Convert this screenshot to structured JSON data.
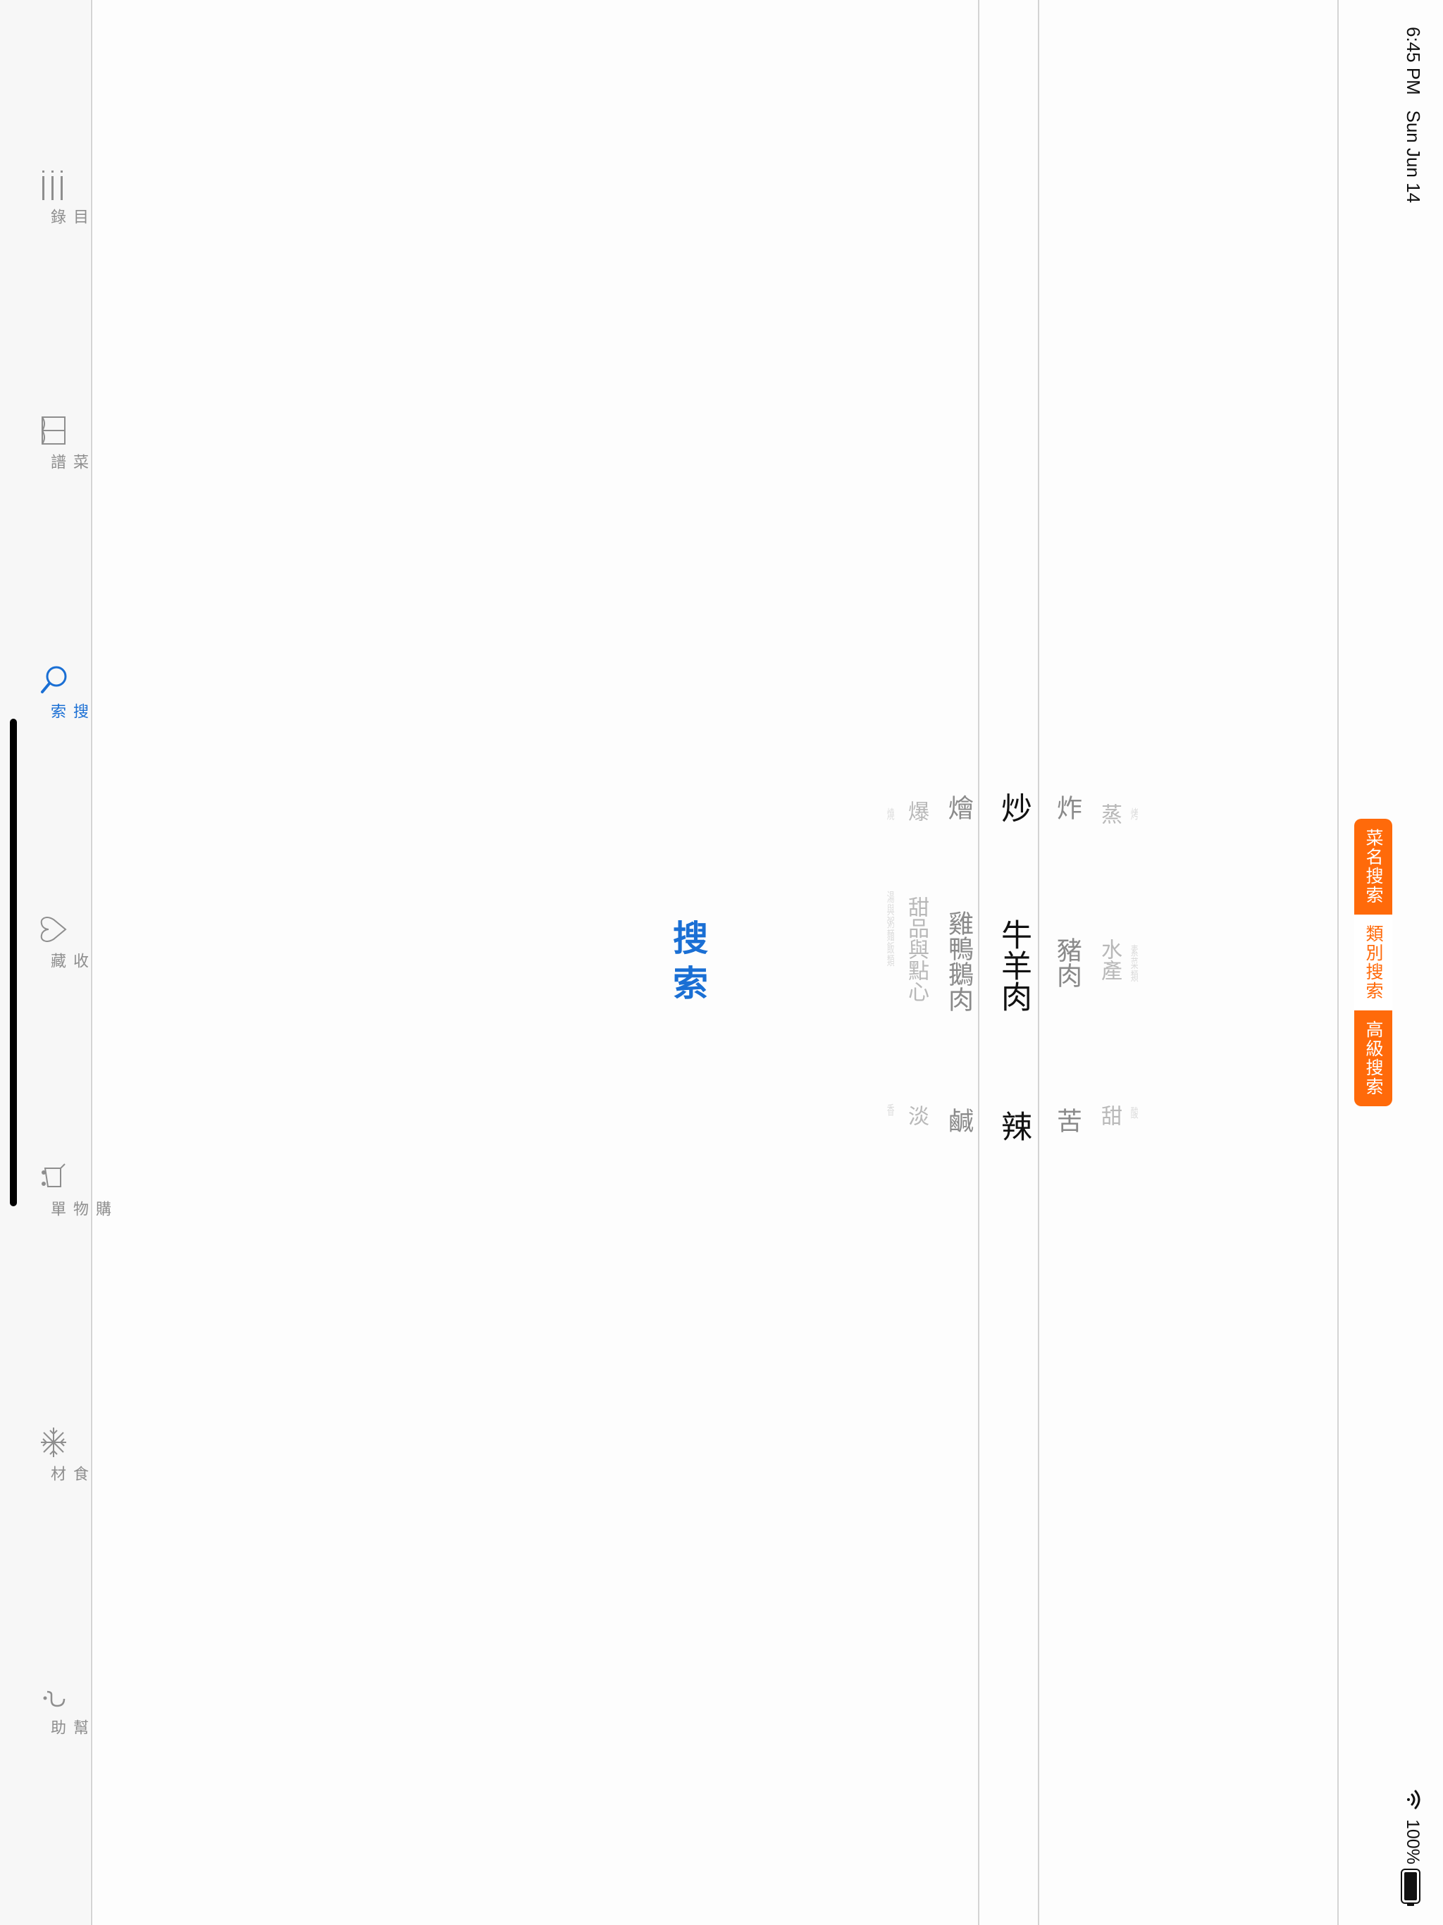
{
  "status_bar": {
    "time_date": "6:45 PM   Sun Jun 14",
    "battery": "100%"
  },
  "segmented_control": {
    "items": [
      {
        "label": "菜名搜索",
        "state": "active"
      },
      {
        "label": "類別搜索",
        "state": "inactive"
      },
      {
        "label": "高級搜索",
        "state": "active"
      }
    ],
    "accent_color": "#ff6a0a"
  },
  "pickers": {
    "cooking_method": {
      "items": [
        "蒸",
        "炸",
        "炒",
        "燴",
        "爆"
      ],
      "selected": "炒"
    },
    "ingredient": {
      "items": [
        "水產",
        "豬肉",
        "牛羊肉",
        "雞鴨鵝肉",
        "甜品與點心"
      ],
      "selected": "牛羊肉"
    },
    "flavor": {
      "items": [
        "甜",
        "苦",
        "辣",
        "鹹",
        "淡"
      ],
      "selected": "辣"
    }
  },
  "search_button": {
    "label": "搜索",
    "color": "#1a6fd4"
  },
  "tab_bar": {
    "items": [
      {
        "label": "目錄",
        "icon": "list-icon"
      },
      {
        "label": "菜譜",
        "icon": "book-icon"
      },
      {
        "label": "搜索",
        "icon": "search-icon",
        "active": true
      },
      {
        "label": "收藏",
        "icon": "heart-icon"
      },
      {
        "label": "購物單",
        "icon": "cart-icon"
      },
      {
        "label": "食材",
        "icon": "snowflake-icon"
      },
      {
        "label": "幫助",
        "icon": "question-icon"
      }
    ],
    "active_color": "#1a6fd4"
  }
}
